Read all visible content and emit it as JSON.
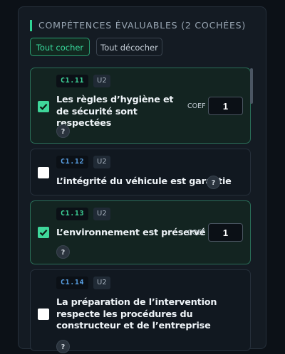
{
  "section": {
    "title": "COMPÉTENCES ÉVALUABLES (2 COCHÉES)",
    "check_all": "Tout cocher",
    "uncheck_all": "Tout décocher"
  },
  "competences": [
    {
      "code": "C1.11",
      "unit": "U2",
      "label": "Les règles d’hygiène et de sécurité sont respectées",
      "checked": true,
      "coef_label": "COEF",
      "coef": "1",
      "help": "?"
    },
    {
      "code": "C1.12",
      "unit": "U2",
      "label": "L’intégrité du véhicule est garantie",
      "checked": false,
      "help": "?"
    },
    {
      "code": "C1.13",
      "unit": "U2",
      "label": "L’environnement est préservé",
      "checked": true,
      "coef_label": "COEF",
      "coef": "1",
      "help": "?"
    },
    {
      "code": "C1.14",
      "unit": "U2",
      "label": "La préparation de l’intervention respecte les procédures du constructeur et de l’entreprise",
      "checked": false,
      "help": "?"
    }
  ],
  "colors": {
    "accent": "#3fd69a",
    "background": "#0c1117",
    "panel": "#141b23"
  }
}
